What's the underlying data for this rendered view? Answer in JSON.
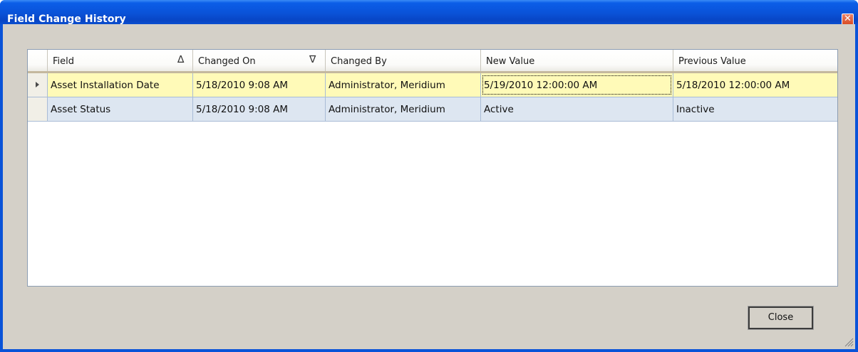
{
  "window": {
    "title": "Field Change History",
    "close_glyph": "✕"
  },
  "grid": {
    "columns": [
      {
        "label": "Field",
        "sort": "ascending"
      },
      {
        "label": "Changed On",
        "sort": "descending"
      },
      {
        "label": "Changed By",
        "sort": "none"
      },
      {
        "label": "New Value",
        "sort": "none"
      },
      {
        "label": "Previous Value",
        "sort": "none"
      }
    ],
    "sort_icons": {
      "ascending": "∆",
      "descending": "∇"
    },
    "rows": [
      {
        "selected": true,
        "field": "Asset Installation Date",
        "changed_on": "5/18/2010 9:08 AM",
        "changed_by": "Administrator, Meridium",
        "new_value": "5/19/2010 12:00:00 AM",
        "previous_value": "5/18/2010 12:00:00 AM"
      },
      {
        "selected": false,
        "field": "Asset Status",
        "changed_on": "5/18/2010 9:08 AM",
        "changed_by": "Administrator, Meridium",
        "new_value": "Active",
        "previous_value": "Inactive"
      }
    ]
  },
  "buttons": {
    "close_label": "Close"
  },
  "colors": {
    "titlebar": "#0a52d8",
    "dialog_background": "#d4d0c8",
    "selected_row": "#fffab8",
    "normal_row": "#dde6f1"
  }
}
